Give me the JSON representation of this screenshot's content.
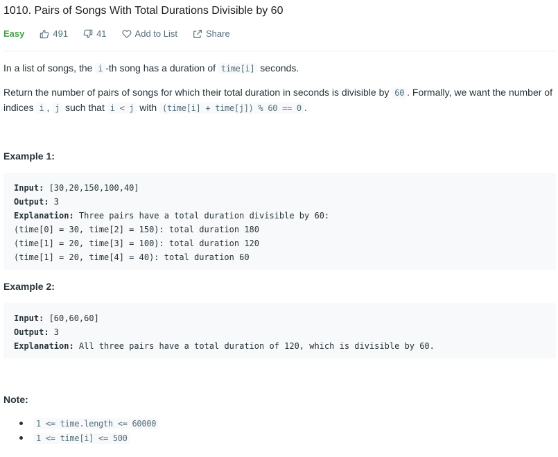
{
  "problem": {
    "title": "1010. Pairs of Songs With Total Durations Divisible by 60",
    "difficulty": "Easy",
    "likes": "491",
    "dislikes": "41",
    "add_to_list": "Add to List",
    "share": "Share"
  },
  "description": {
    "p1_before": "In a list of songs, the ",
    "p1_code": "i",
    "p1_after": "-th song has a duration of ",
    "p1_code2": "time[i]",
    "p1_end": " seconds.",
    "p2_a": "Return the number of pairs of songs for which their total duration in seconds is divisible by ",
    "p2_code1": "60",
    "p2_b": ".  Formally, we want the number of indices ",
    "p2_code2": "i",
    "p2_c": ", ",
    "p2_code3": "j",
    "p2_d": " such that ",
    "p2_code4": "i < j",
    "p2_e": " with ",
    "p2_code5": "(time[i] + time[j]) % 60 == 0",
    "p2_f": "."
  },
  "example1": {
    "heading": "Example 1:",
    "input_label": "Input:",
    "input_value": " [30,20,150,100,40]",
    "output_label": "Output:",
    "output_value": " 3",
    "explanation_label": "Explanation:",
    "explanation_value": " Three pairs have a total duration divisible by 60:",
    "lines": [
      "(time[0] = 30, time[2] = 150): total duration 180",
      "(time[1] = 20, time[3] = 100): total duration 120",
      "(time[1] = 20, time[4] = 40): total duration 60"
    ]
  },
  "example2": {
    "heading": "Example 2:",
    "input_label": "Input:",
    "input_value": " [60,60,60]",
    "output_label": "Output:",
    "output_value": " 3",
    "explanation_label": "Explanation:",
    "explanation_value": " All three pairs have a total duration of 120, which is divisible by 60."
  },
  "note": {
    "heading": "Note:",
    "items": [
      "1 <= time.length <= 60000",
      "1 <= time[i] <= 500"
    ]
  }
}
